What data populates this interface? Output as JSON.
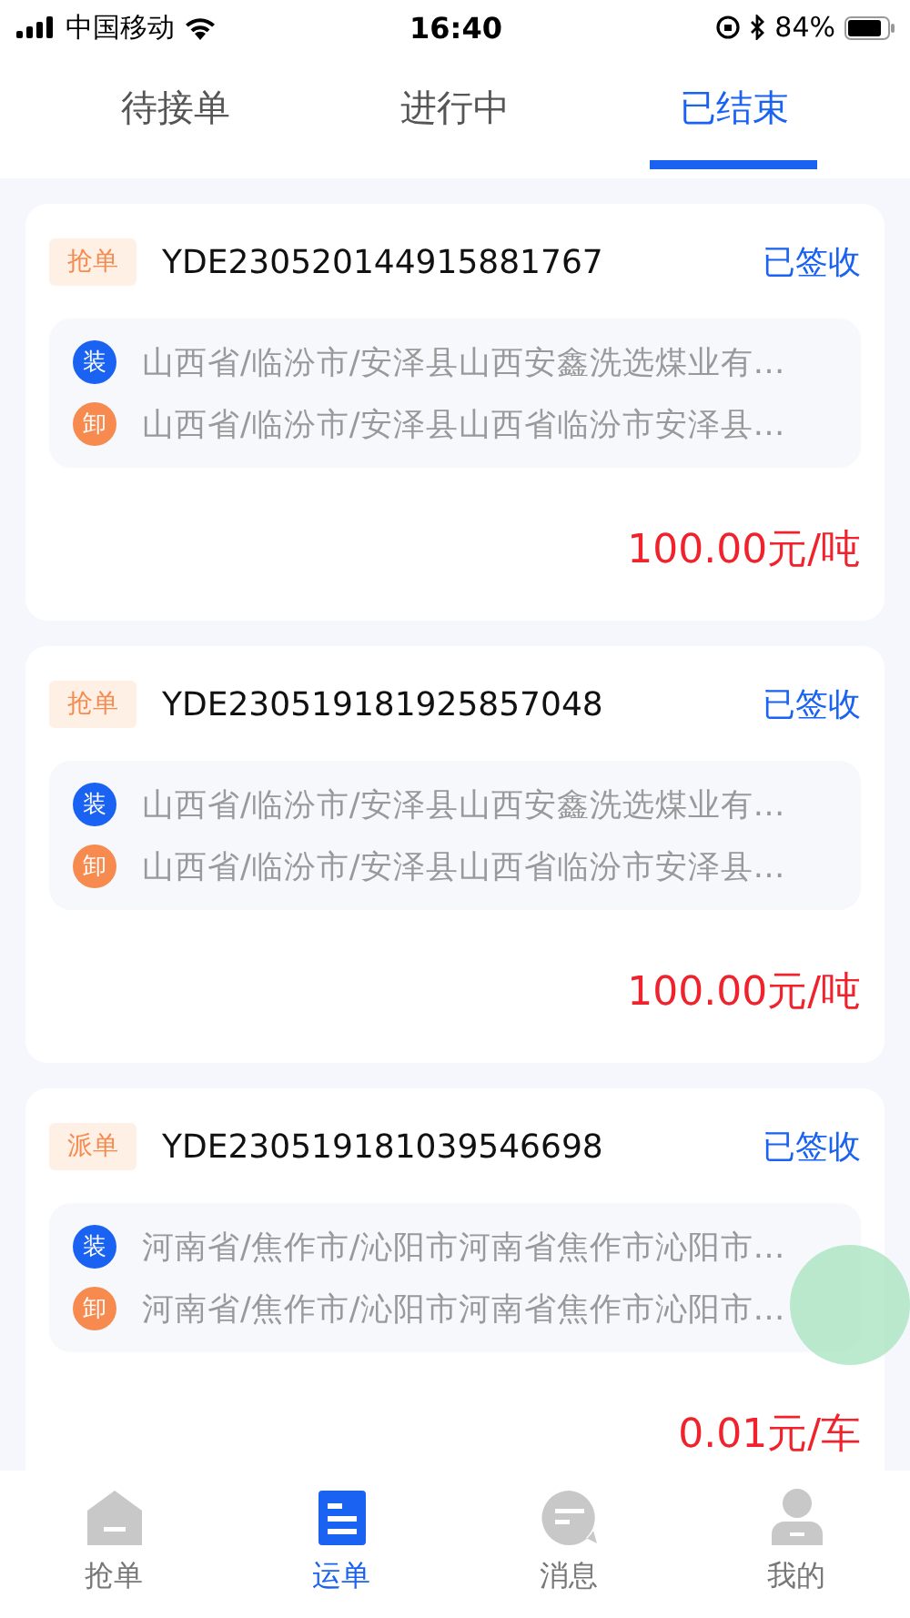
{
  "status_bar": {
    "carrier": "中国移动",
    "time": "16:40",
    "battery": "84%"
  },
  "tabs": [
    {
      "label": "待接单",
      "selected": false
    },
    {
      "label": "进行中",
      "selected": false
    },
    {
      "label": "已结束",
      "selected": true
    }
  ],
  "orders": [
    {
      "tag": "抢单",
      "number": "YDE230520144915881767",
      "status": "已签收",
      "stops": [
        {
          "kind": "load",
          "badge": "装",
          "address": "山西省/临汾市/安泽县山西安鑫洗选煤业有…"
        },
        {
          "kind": "unload",
          "badge": "卸",
          "address": "山西省/临汾市/安泽县山西省临汾市安泽县…"
        }
      ],
      "price": "100.00元/吨"
    },
    {
      "tag": "抢单",
      "number": "YDE230519181925857048",
      "status": "已签收",
      "stops": [
        {
          "kind": "load",
          "badge": "装",
          "address": "山西省/临汾市/安泽县山西安鑫洗选煤业有…"
        },
        {
          "kind": "unload",
          "badge": "卸",
          "address": "山西省/临汾市/安泽县山西省临汾市安泽县…"
        }
      ],
      "price": "100.00元/吨"
    },
    {
      "tag": "派单",
      "number": "YDE230519181039546698",
      "status": "已签收",
      "stops": [
        {
          "kind": "load",
          "badge": "装",
          "address": "河南省/焦作市/沁阳市河南省焦作市沁阳市…"
        },
        {
          "kind": "unload",
          "badge": "卸",
          "address": "河南省/焦作市/沁阳市河南省焦作市沁阳市…"
        }
      ],
      "price": "0.01元/车"
    }
  ],
  "bottom_nav": [
    {
      "kind": "grab",
      "label": "抢单",
      "selected": false
    },
    {
      "kind": "waybill",
      "label": "运单",
      "selected": true
    },
    {
      "kind": "message",
      "label": "消息",
      "selected": false
    },
    {
      "kind": "profile",
      "label": "我的",
      "selected": false
    }
  ]
}
